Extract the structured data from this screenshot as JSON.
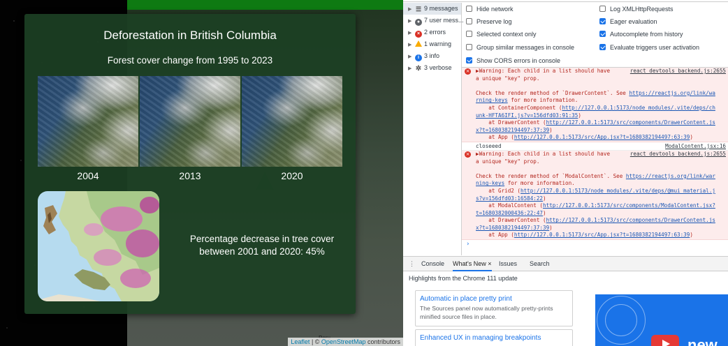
{
  "app": {
    "card": {
      "title": "Deforestation in British Columbia",
      "subtitle": "Forest cover change from 1995 to 2023",
      "images": [
        {
          "year": "2004"
        },
        {
          "year": "2013"
        },
        {
          "year": "2020"
        }
      ],
      "stat_text": "Percentage decrease in tree cover between 2001 and 2020: 45%"
    },
    "map": {
      "place_label": "Peru",
      "attribution_leaflet": "Leaflet",
      "attribution_sep": " | © ",
      "attribution_osm": "OpenStreetMap",
      "attribution_tail": " contributors"
    }
  },
  "devtools": {
    "sidebar": [
      {
        "label": "9 messages",
        "icon": "list-icon"
      },
      {
        "label": "7 user mess...",
        "icon": "user-icon"
      },
      {
        "label": "2 errors",
        "icon": "error-icon"
      },
      {
        "label": "1 warning",
        "icon": "warning-icon"
      },
      {
        "label": "3 info",
        "icon": "info-icon"
      },
      {
        "label": "3 verbose",
        "icon": "verbose-icon"
      }
    ],
    "settings": {
      "hide_network": "Hide network",
      "preserve_log": "Preserve log",
      "selected_context": "Selected context only",
      "group_similar": "Group similar messages in console",
      "show_cors": "Show CORS errors in console",
      "log_xhr": "Log XMLHttpRequests",
      "eager_eval": "Eager evaluation",
      "autocomplete": "Autocomplete from history",
      "eval_triggers": "Evaluate triggers user activation"
    },
    "messages": {
      "warn1": {
        "line1": "▶Warning: Each child in a list should have",
        "source": "react_devtools_backend.js:2655",
        "line2": "a unique \"key\" prop.",
        "check_pre": "Check the render method of `DrawerContent`. See ",
        "check_link_a": "https://reactjs.org/link/wa",
        "check_link_b": "rning-keys",
        "check_post": " for more information.",
        "frame1_pre": "    at ContainerComponent (",
        "frame1_link_a": "http://127.0.0.1:5173/node_modules/.vite/deps/ch",
        "frame1_link_b": "unk-HFTA6IFI.js?v=156dfd03:91:35",
        "frame2_pre": "    at DrawerContent (",
        "frame2_link_a": "http://127.0.0.1:5173/src/components/DrawerContent.js",
        "frame2_link_b": "x?t=1680382194497:37:39",
        "frame3_pre": "    at App (",
        "frame3_link": "http://127.0.0.1:5173/src/App.jsx?t=1680382194497:63:39"
      },
      "log": {
        "text": "closeeed",
        "source": "ModalContent.jsx:16"
      },
      "warn2": {
        "line1": "▶Warning: Each child in a list should have",
        "source": "react_devtools_backend.js:2655",
        "line2": "a unique \"key\" prop.",
        "check_pre": "Check the render method of `ModalContent`. See ",
        "check_link_a": "https://reactjs.org/link/war",
        "check_link_b": "ning-keys",
        "check_post": " for more information.",
        "frame1_pre": "    at Grid2 (",
        "frame1_link_a": "http://127.0.0.1:5173/node_modules/.vite/deps/@mui_material.j",
        "frame1_link_b": "s?v=156dfd03:16584:22",
        "frame2_pre": "    at ModalContent (",
        "frame2_link_a": "http://127.0.0.1:5173/src/components/ModalContent.jsx?",
        "frame2_link_b": "t=1680382000436:22:47",
        "frame3_pre": "    at DrawerContent (",
        "frame3_link_a": "http://127.0.0.1:5173/src/components/DrawerContent.js",
        "frame3_link_b": "x?t=1680382194497:37:39",
        "frame4_pre": "    at App (",
        "frame4_link": "http://127.0.0.1:5173/src/App.jsx?t=1680382194497:63:39"
      },
      "prompt": "›"
    },
    "drawer": {
      "menu_icon": "⋮",
      "tabs": [
        "Console",
        "What's New",
        "Issues",
        "Search"
      ],
      "close": "×",
      "highlights": "Highlights from the Chrome 111 update",
      "cards": [
        {
          "title": "Automatic in place pretty print",
          "desc": "The Sources panel now automatically pretty-prints minified source files in place."
        },
        {
          "title": "Enhanced UX in managing breakpoints",
          "desc": ""
        }
      ],
      "promo_word": "new"
    }
  }
}
